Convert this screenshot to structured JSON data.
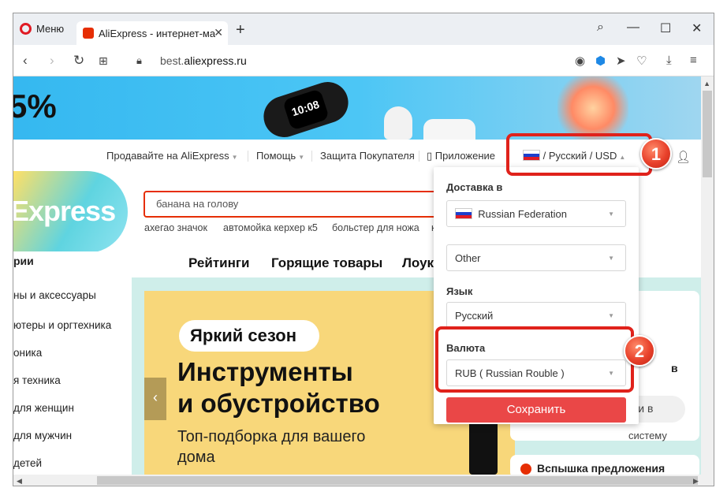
{
  "browser": {
    "menu_label": "Меню",
    "tab_title": "AliExpress - интернет-мага",
    "url_prefix": "best.",
    "url_domain": "aliexpress.ru"
  },
  "banner": {
    "promo": "5%",
    "watch_time": "10:08"
  },
  "topnav": {
    "sell": "Продавайте на AliExpress",
    "help": "Помощь",
    "protection": "Защита Покупателя",
    "app": "Приложение",
    "locale": "/ Русский /  USD"
  },
  "logo_text": "Express",
  "search": {
    "value": "банана на голову"
  },
  "suggestions": [
    "ахегао значок",
    "автомойка керхер к5",
    "больстер для ножа",
    "к"
  ],
  "categories": {
    "heading": "рии",
    "items": [
      "ны и аксессуары",
      "ютеры и оргтехника",
      "оника",
      "я техника",
      "для женщин",
      "для мужчин",
      "детей"
    ]
  },
  "main_nav": [
    "Рейтинги",
    "Горящие товары",
    "Лоук"
  ],
  "hero": {
    "badge": "Яркий сезон",
    "title_line1": "Инструменты",
    "title_line2": "и обустройство",
    "subtitle_line1": "Топ-подборка для вашего",
    "subtitle_line2": "дома"
  },
  "right_card": {
    "partial": "в",
    "login_partial": "йти в",
    "system": "систему"
  },
  "flash": "Вспышка предложения",
  "dropdown": {
    "shipping_label": "Доставка в",
    "country": "Russian Federation",
    "region": "Other",
    "language_label": "Язык",
    "language": "Русский",
    "currency_label": "Валюта",
    "currency": "RUB ( Russian Rouble )",
    "save": "Сохранить"
  },
  "annotations": [
    "1",
    "2"
  ],
  "colors": {
    "accent": "#e62e04",
    "save": "#ea4747",
    "highlight": "#e0221b"
  }
}
